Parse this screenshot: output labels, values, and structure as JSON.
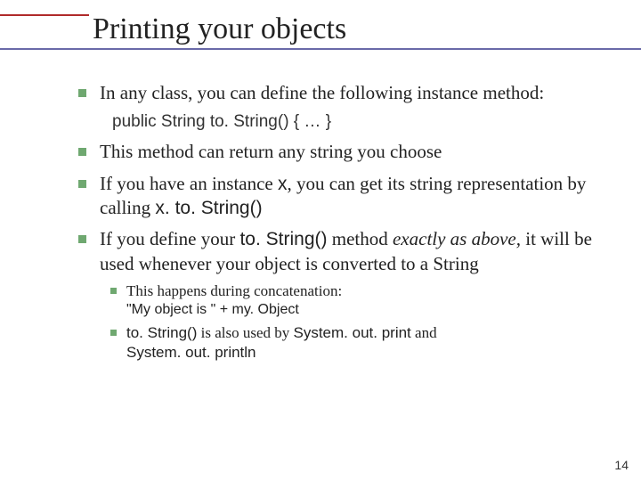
{
  "title": "Printing your objects",
  "bullets": {
    "b1": "In any class, you can define the following instance method:",
    "b1_code": "public String to. String() { … }",
    "b2": "This method can return any string you choose",
    "b3_pre": "If you have an instance ",
    "b3_x": "x",
    "b3_mid": ", you can get its string representation by calling ",
    "b3_call": "x. to. String()",
    "b4_pre": "If you define your ",
    "b4_code": "to. String()",
    "b4_mid": " method ",
    "b4_ital": "exactly as above,",
    "b4_post": " it will be used whenever your object is converted to a String"
  },
  "sub": {
    "s1": "This happens during concatenation:",
    "s1_code": "\"My object is \" + my. Object",
    "s2_code1": "to. String()",
    "s2_mid": " is also used by ",
    "s2_code2": "System. out. print",
    "s2_and": " and ",
    "s2_code3": "System. out. println"
  },
  "page": "14"
}
